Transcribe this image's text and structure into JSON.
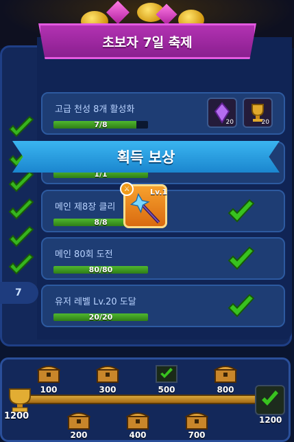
{
  "event_title": "초보자 7일 축제",
  "banner_text": "획득 보상",
  "side_day_label": "7",
  "missions": [
    {
      "title": "고급 천성 8개 활성화",
      "progress_text": "7/8",
      "progress": 0.875,
      "completed": false,
      "rewards": [
        {
          "icon": "purple-gem-icon",
          "count": "20"
        },
        {
          "icon": "trophy-icon",
          "count": "20"
        }
      ]
    },
    {
      "title": "",
      "progress_text": "1/1",
      "progress": 1.0,
      "completed": true
    },
    {
      "title": "메인 제8장 클리",
      "progress_text": "8/8",
      "progress": 1.0,
      "completed": true
    },
    {
      "title": "메인 80회 도전",
      "progress_text": "80/80",
      "progress": 1.0,
      "completed": true
    },
    {
      "title": "유저 레벨 Lv.20 도달",
      "progress_text": "20/20",
      "progress": 1.0,
      "completed": true
    }
  ],
  "reward_popup": {
    "item": "weapon-staff-icon",
    "level_label": "Lv.1"
  },
  "milestones": {
    "start_label": "1200",
    "end_label": "1200",
    "top": [
      "100",
      "300",
      "500",
      "800"
    ],
    "bottom": [
      "200",
      "400",
      "700"
    ]
  },
  "colors": {
    "accent_purple": "#b232b2",
    "accent_blue": "#2a9fe0",
    "check_green": "#38c21f",
    "progress_green": "#3fa325"
  }
}
